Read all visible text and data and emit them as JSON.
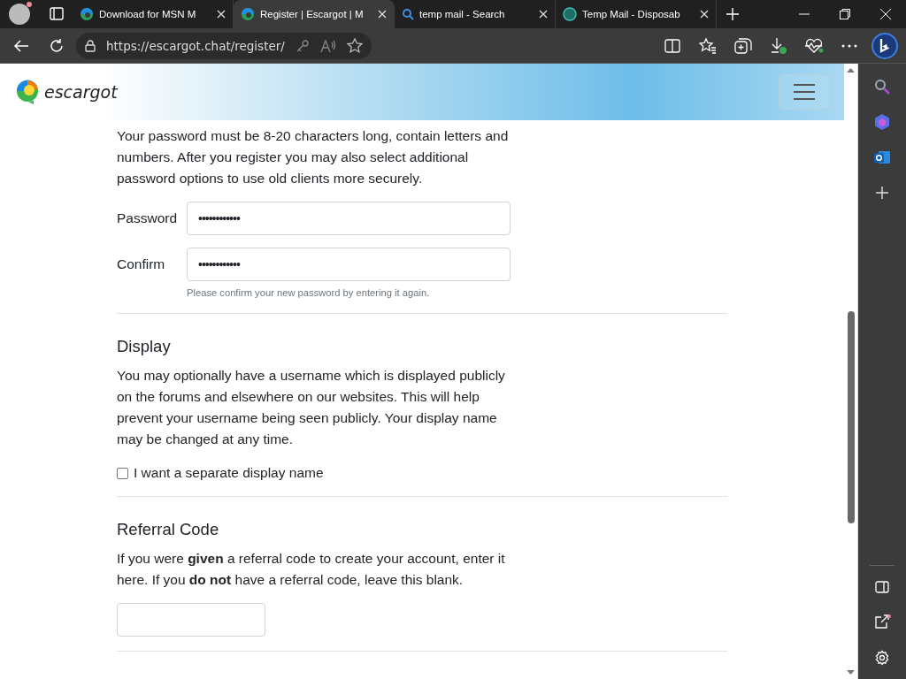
{
  "browser": {
    "tabs": [
      {
        "kind": "edge",
        "title": "Download for MSN M",
        "selected": false
      },
      {
        "kind": "edge",
        "title": "Register | Escargot | M",
        "selected": true
      },
      {
        "kind": "search",
        "title": "temp mail - Search",
        "selected": false
      },
      {
        "kind": "mail",
        "title": "Temp Mail - Disposab",
        "selected": false
      }
    ],
    "url": "https://escargot.chat/register/"
  },
  "site": {
    "logo_text": "escargot"
  },
  "password_section": {
    "intro": "Your password must be 8-20 characters long, contain letters and numbers. After you register you may also select additional password options to use old clients more securely.",
    "fields": [
      {
        "label": "Password",
        "value": "••••••••••••"
      },
      {
        "label": "Confirm",
        "value": "••••••••••••",
        "help": "Please confirm your new password by entering it again."
      }
    ]
  },
  "display_section": {
    "heading": "Display",
    "text": "You may optionally have a username which is displayed publicly on the forums and elsewhere on our websites. This will help prevent your username being seen publicly. Your display name may be changed at any time.",
    "checkbox": {
      "label": "I want a separate display name",
      "checked": false
    }
  },
  "referral_section": {
    "heading": "Referral Code",
    "text": "If you were **given** a referral code to create your account, enter it here. If you **do not** have a referral code, leave this blank."
  }
}
